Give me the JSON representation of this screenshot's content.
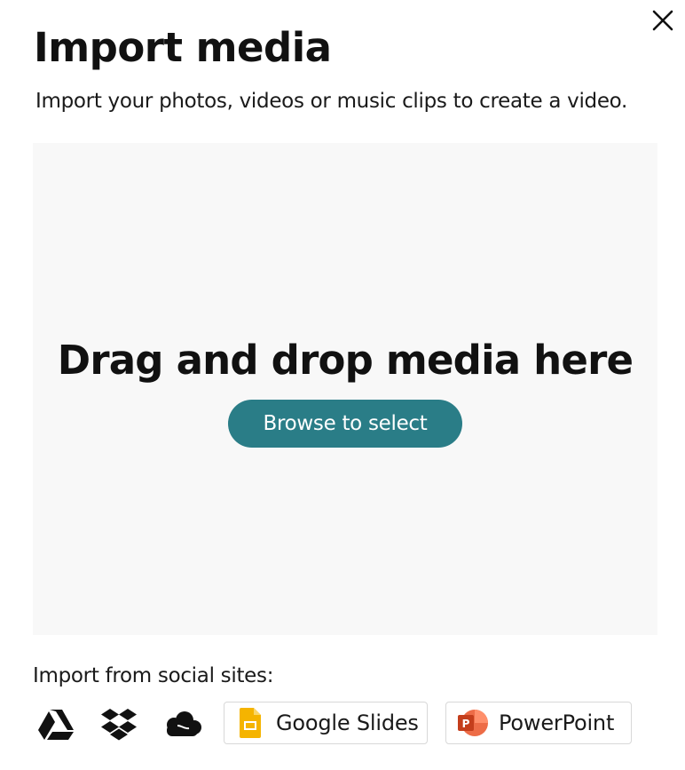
{
  "dialog": {
    "title": "Import media",
    "subtitle": "Import your photos, videos or music clips to create a video."
  },
  "dropzone": {
    "heading": "Drag and drop media here",
    "browse_label": "Browse to select"
  },
  "social": {
    "label": "Import from social sites:",
    "icons": [
      "google-drive-icon",
      "dropbox-icon",
      "onedrive-icon"
    ],
    "google_slides_label": "Google Slides",
    "powerpoint_label": "PowerPoint"
  },
  "colors": {
    "accent": "#2a7d87",
    "dropzone_bg": "#f8f8f8",
    "google_slides": "#f5b400",
    "powerpoint": "#d04423"
  }
}
